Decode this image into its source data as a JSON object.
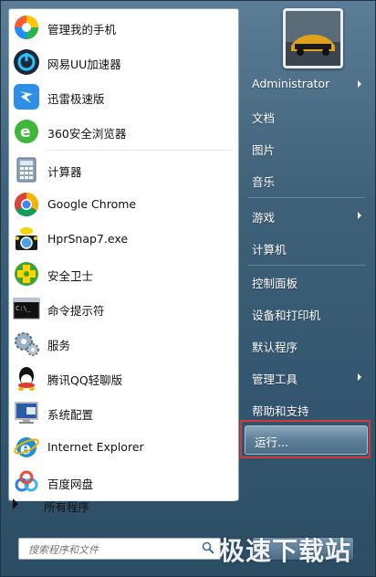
{
  "left_programs": [
    {
      "label": "管理我的手机",
      "icon": "phone-manager-icon"
    },
    {
      "label": "网易UU加速器",
      "icon": "uu-accelerator-icon"
    },
    {
      "label": "迅雷极速版",
      "icon": "thunder-icon"
    },
    {
      "label": "360安全浏览器",
      "icon": "360-browser-icon"
    },
    {
      "label": "计算器",
      "icon": "calculator-icon"
    },
    {
      "label": "Google Chrome",
      "icon": "chrome-icon"
    },
    {
      "label": "HprSnap7.exe",
      "icon": "hypersnap-icon"
    },
    {
      "label": "安全卫士",
      "icon": "security-guard-icon"
    },
    {
      "label": "命令提示符",
      "icon": "cmd-icon"
    },
    {
      "label": "服务",
      "icon": "services-icon"
    },
    {
      "label": "腾讯QQ轻聊版",
      "icon": "qq-icon"
    },
    {
      "label": "系统配置",
      "icon": "msconfig-icon"
    },
    {
      "label": "Internet Explorer",
      "icon": "ie-icon"
    },
    {
      "label": "百度网盘",
      "icon": "baidu-netdisk-icon"
    }
  ],
  "all_programs": "所有程序",
  "search": {
    "placeholder": "搜索程序和文件"
  },
  "right_items": [
    {
      "label": "Administrator",
      "arrow": true
    },
    {
      "label": "文档",
      "arrow": false
    },
    {
      "label": "图片",
      "arrow": false
    },
    {
      "label": "音乐",
      "arrow": false
    },
    {
      "label": "游戏",
      "arrow": true
    },
    {
      "label": "计算机",
      "arrow": false
    },
    {
      "label": "控制面板",
      "arrow": false
    },
    {
      "label": "设备和打印机",
      "arrow": false
    },
    {
      "label": "默认程序",
      "arrow": false
    },
    {
      "label": "管理工具",
      "arrow": true
    },
    {
      "label": "帮助和支持",
      "arrow": false
    }
  ],
  "run_label": "运行...",
  "watermark": "极速下载站",
  "colors": {
    "highlight_border": "#d23a3a"
  }
}
